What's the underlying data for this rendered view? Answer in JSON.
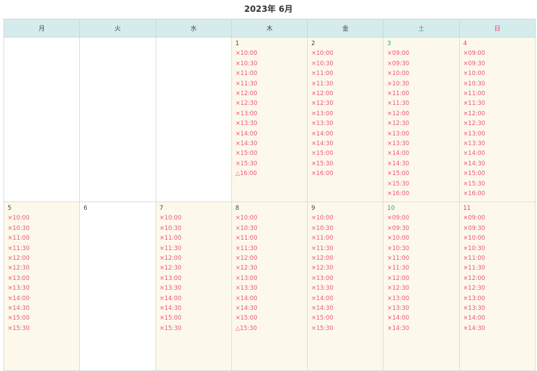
{
  "calendar": {
    "title": "2023年 6月",
    "weekdays": [
      "月",
      "火",
      "水",
      "木",
      "金",
      "土",
      "日"
    ],
    "weeks": [
      {
        "days": [
          null,
          null,
          null,
          {
            "num": "1",
            "slots": [
              "×10:00",
              "×10:30",
              "×11:00",
              "×11:30",
              "×12:00",
              "×12:30",
              "×13:00",
              "×13:30",
              "×14:00",
              "×14:30",
              "×15:00",
              "×15:30",
              "△16:00"
            ]
          },
          {
            "num": "2",
            "slots": [
              "×10:00",
              "×10:30",
              "×11:00",
              "×11:30",
              "×12:00",
              "×12:30",
              "×13:00",
              "×13:30",
              "×14:00",
              "×14:30",
              "×15:00",
              "×15:30",
              "×16:00"
            ]
          },
          {
            "num": "3",
            "slots": [
              "×09:00",
              "×09:30",
              "×10:00",
              "×10:30",
              "×11:00",
              "×11:30",
              "×12:00",
              "×12:30",
              "×13:00",
              "×13:30",
              "×14:00",
              "×14:30",
              "×15:00",
              "×15:30",
              "×16:00"
            ]
          },
          {
            "num": "4",
            "slots": [
              "×09:00",
              "×09:30",
              "×10:00",
              "×10:30",
              "×11:00",
              "×11:30",
              "×12:00",
              "×12:30",
              "×13:00",
              "×13:30",
              "×14:00",
              "×14:30",
              "×15:00",
              "×15:30",
              "×16:00"
            ]
          }
        ]
      },
      {
        "days": [
          {
            "num": "5",
            "slots": [
              "×10:00",
              "×10:30",
              "×11:00",
              "×11:30",
              "×12:00",
              "×12:30",
              "×13:00",
              "×13:30",
              "×14:00",
              "×14:30",
              "×15:00",
              "×15:30"
            ]
          },
          {
            "num": "6",
            "slots": []
          },
          {
            "num": "7",
            "slots": [
              "×10:00",
              "×10:30",
              "×11:00",
              "×11:30",
              "×12:00",
              "×12:30",
              "×13:00",
              "×13:30",
              "×14:00",
              "×14:30",
              "×15:00",
              "×15:30"
            ]
          },
          {
            "num": "8",
            "slots": [
              "×10:00",
              "×10:30",
              "×11:00",
              "×11:30",
              "×12:00",
              "×12:30",
              "×13:00",
              "×13:30",
              "×14:00",
              "×14:30",
              "×15:00",
              "△15:30"
            ]
          },
          {
            "num": "9",
            "slots": [
              "×10:00",
              "×10:30",
              "×11:00",
              "×11:30",
              "×12:00",
              "×12:30",
              "×13:00",
              "×13:30",
              "×14:00",
              "×14:30",
              "×15:00",
              "×15:30"
            ]
          },
          {
            "num": "10",
            "slots": [
              "×09:00",
              "×09:30",
              "×10:00",
              "×10:30",
              "×11:00",
              "×11:30",
              "×12:00",
              "×12:30",
              "×13:00",
              "×13:30",
              "×14:00",
              "×14:30"
            ]
          },
          {
            "num": "11",
            "slots": [
              "×09:00",
              "×09:30",
              "×10:00",
              "×10:30",
              "×11:00",
              "×11:30",
              "×12:00",
              "×12:30",
              "×13:00",
              "×13:30",
              "×14:00",
              "×14:30"
            ]
          }
        ]
      }
    ]
  }
}
